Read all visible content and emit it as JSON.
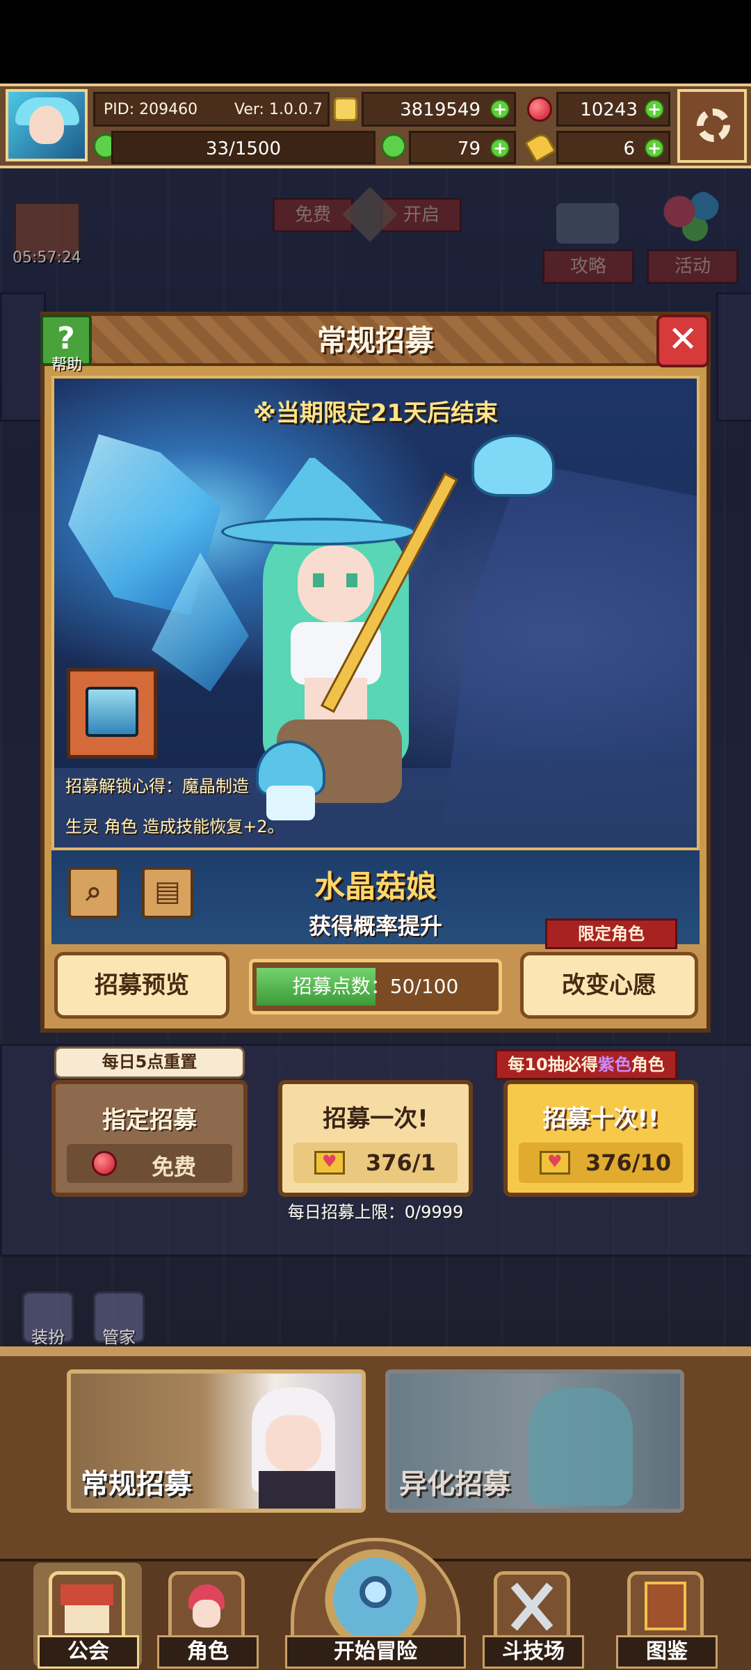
{
  "hud": {
    "pid": "PID: 209460",
    "version": "Ver: 1.0.0.7",
    "gold": "3819549",
    "gems": "10243",
    "stamina": "33/1500",
    "clovers": "79",
    "keys": "6"
  },
  "background": {
    "timer": "05:57:24",
    "free_label_left": "免费",
    "free_label_right": "开启",
    "guide_label": "攻略",
    "event_label": "活动"
  },
  "modal": {
    "title": "常规招募",
    "help_label": "帮助",
    "limited_time": "※当期限定21天后结束",
    "unlock_text": "招募解锁心得：魔晶制造",
    "skill_text": "生灵 角色 造成技能恢复+2。",
    "char_name": "水晶菇娘",
    "rate_up": "获得概率提升",
    "preview_label": "招募预览",
    "points_label": "招募点数：",
    "points_value": "50/100",
    "points_fraction": 0.5,
    "limited_char_tag": "限定角色",
    "change_wish_label": "改变心愿"
  },
  "recruit": {
    "daily_reset_tag": "每日5点重置",
    "designated_title": "指定招募",
    "designated_cost": "免费",
    "single_title": "招募一次!",
    "single_cost": "376/1",
    "ten_title": "招募十次!!",
    "ten_cost": "376/10",
    "guarantee_prefix": "每10抽必得",
    "guarantee_color_word": "紫色",
    "guarantee_suffix": "角色",
    "daily_limit": "每日招募上限：0/9999"
  },
  "side": {
    "dressup_label": "装扮",
    "butler_label": "管家"
  },
  "banners": {
    "normal_label": "常规招募",
    "mutation_label": "异化招募"
  },
  "nav": {
    "guild": "公会",
    "character": "角色",
    "adventure": "开始冒险",
    "arena": "斗技场",
    "codex": "图鉴"
  },
  "colors": {
    "accent_gold": "#ffd76a",
    "purple": "#b56cff",
    "nav_active": "#f1d48d"
  }
}
